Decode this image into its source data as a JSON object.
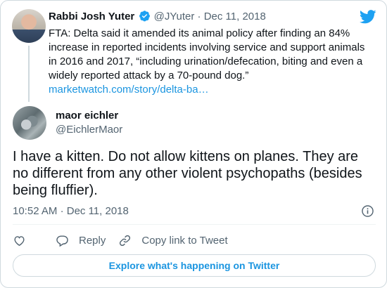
{
  "parent_tweet": {
    "name": "Rabbi Josh Yuter",
    "handle": "@JYuter",
    "separator": "·",
    "date": "Dec 11, 2018",
    "text": "FTA: Delta said it amended its animal policy after finding an 84% increase in reported incidents involving service and support animals in 2016 and 2017, “including urination/defecation, biting and even a widely reported attack by a 70-pound dog.”",
    "link": "marketwatch.com/story/delta-ba…"
  },
  "reply_tweet": {
    "name": "maor eichler",
    "handle": "@EichlerMaor",
    "text": "I have a kitten. Do not allow kittens on planes. They are no different from any other violent psychopaths (besides being fluffier).",
    "time": "10:52 AM",
    "separator": "·",
    "date": "Dec 11, 2018"
  },
  "actions": {
    "reply_label": "Reply",
    "copy_link_label": "Copy link to Tweet"
  },
  "explore_label": "Explore what's happening on Twitter",
  "colors": {
    "brand": "#1da1f2",
    "link": "#1b95e0",
    "muted": "#536471",
    "border": "#cfd9de"
  }
}
